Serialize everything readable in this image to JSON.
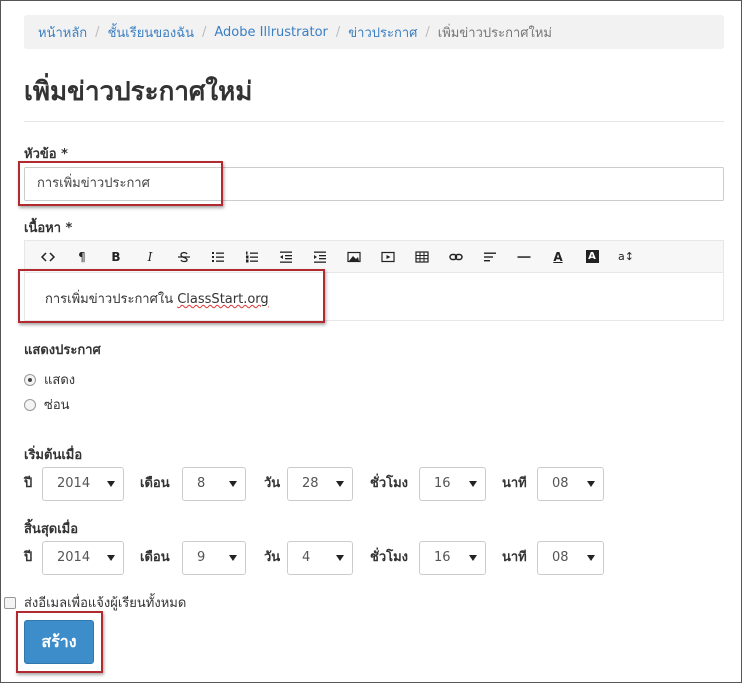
{
  "breadcrumb": {
    "items": [
      "หน้าหลัก",
      "ชั้นเรียนของฉัน",
      "Adobe Illrustrator",
      "ข่าวประกาศ"
    ],
    "current": "เพิ่มข่าวประกาศใหม่"
  },
  "page": {
    "title": "เพิ่มข่าวประกาศใหม่"
  },
  "form": {
    "subject_label": "หัวข้อ *",
    "subject_value": "การเพิ่มข่าวประกาศ",
    "content_label": "เนื้อหา *",
    "content_text": "การเพิ่มข่าวประกาศใน ",
    "content_link": "ClassStart.org",
    "toolbar": {
      "icons": [
        "code-view-icon",
        "paragraph-icon",
        "bold-icon",
        "italic-icon",
        "strikethrough-icon",
        "unordered-list-icon",
        "ordered-list-icon",
        "outdent-icon",
        "indent-icon",
        "image-icon",
        "video-icon",
        "table-icon",
        "link-icon",
        "align-icon",
        "horizontal-rule-icon",
        "font-color-icon",
        "background-color-icon",
        "font-size-icon"
      ],
      "labels": {
        "paragraph": "¶",
        "bold": "B",
        "italic": "I",
        "font_color": "A",
        "background_color": "A",
        "font_size": "a↕"
      }
    },
    "display_label": "แสดงประกาศ",
    "display_options": [
      {
        "label": "แสดง",
        "checked": true
      },
      {
        "label": "ซ่อน",
        "checked": false
      }
    ],
    "start_label": "เริ่มต้นเมื่อ",
    "end_label": "สิ้นสุดเมื่อ",
    "date_labels": {
      "year": "ปี",
      "month": "เดือน",
      "day": "วัน",
      "hour": "ชั่วโมง",
      "minute": "นาที"
    },
    "start": {
      "year": "2014",
      "month": "8",
      "day": "28",
      "hour": "16",
      "minute": "08"
    },
    "end": {
      "year": "2014",
      "month": "9",
      "day": "4",
      "hour": "16",
      "minute": "08"
    },
    "notify_label": "ส่งอีเมลเพื่อแจ้งผู้เรียนทั้งหมด",
    "notify_checked": false,
    "submit_label": "สร้าง"
  },
  "colors": {
    "primary": "#3c8dca",
    "link": "#3a7fc2",
    "highlight": "#b02a30"
  }
}
